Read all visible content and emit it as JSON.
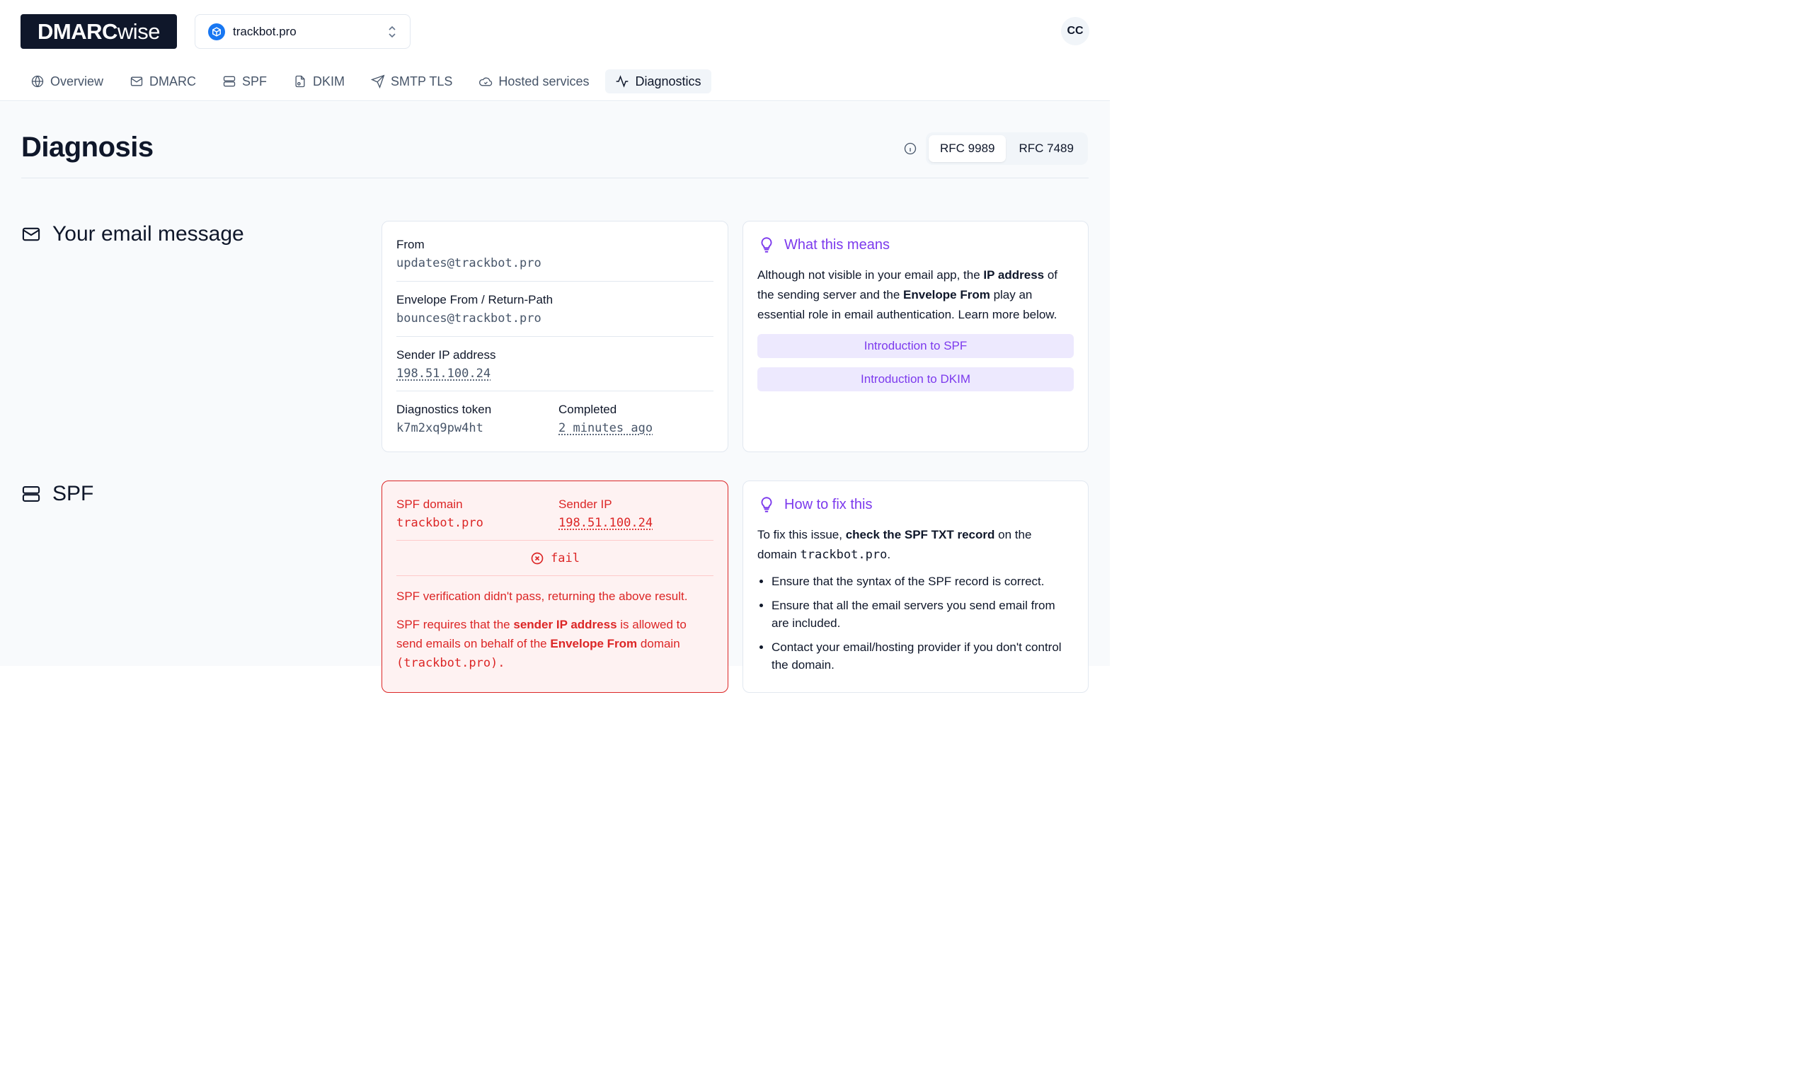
{
  "header": {
    "logo_bold": "DMARC",
    "logo_light": "wise",
    "domain": "trackbot.pro",
    "avatar": "CC"
  },
  "tabs": [
    {
      "label": "Overview",
      "icon": "globe-icon"
    },
    {
      "label": "DMARC",
      "icon": "mail-icon"
    },
    {
      "label": "SPF",
      "icon": "server-icon"
    },
    {
      "label": "DKIM",
      "icon": "file-key-icon"
    },
    {
      "label": "SMTP TLS",
      "icon": "send-icon"
    },
    {
      "label": "Hosted services",
      "icon": "cloud-icon"
    },
    {
      "label": "Diagnostics",
      "icon": "activity-icon",
      "active": true
    }
  ],
  "page": {
    "title": "Diagnosis",
    "rfc_options": [
      "RFC 9989",
      "RFC 7489"
    ],
    "rfc_selected": "RFC 9989"
  },
  "email_section": {
    "title": "Your email message",
    "from_label": "From",
    "from_value": "updates@trackbot.pro",
    "envelope_label": "Envelope From / Return-Path",
    "envelope_value": "bounces@trackbot.pro",
    "ip_label": "Sender IP address",
    "ip_value": "198.51.100.24",
    "token_label": "Diagnostics token",
    "token_value": "k7m2xq9pw4ht",
    "completed_label": "Completed",
    "completed_value": "2 minutes ago"
  },
  "what_means": {
    "title": "What this means",
    "text_1": "Although not visible in your email app, the ",
    "bold_1": "IP address",
    "text_2": " of the sending server and the ",
    "bold_2": "Envelope From",
    "text_3": " play an essential role in email authentication. Learn more below.",
    "btn_spf": "Introduction to SPF",
    "btn_dkim": "Introduction to DKIM"
  },
  "spf_section": {
    "title": "SPF",
    "domain_label": "SPF domain",
    "domain_value": "trackbot.pro",
    "ip_label": "Sender IP",
    "ip_value": "198.51.100.24",
    "result": "fail",
    "msg_1": "SPF verification didn't pass, returning the above result.",
    "msg_2a": "SPF requires that the ",
    "msg_2b": "sender IP address",
    "msg_2c": " is allowed to send emails on behalf of the ",
    "msg_2d": "Envelope From",
    "msg_2e": " domain",
    "msg_2f": "(trackbot.pro)."
  },
  "how_fix": {
    "title": "How to fix this",
    "text_1": "To fix this issue, ",
    "bold_1": "check the SPF TXT record",
    "text_2": " on the domain ",
    "code_1": "trackbot.pro",
    "text_3": ".",
    "items": [
      "Ensure that the syntax of the SPF record is correct.",
      "Ensure that all the email servers you send email from are included.",
      "Contact your email/hosting provider if you don't control the domain."
    ]
  },
  "colors": {
    "accent": "#7c3aed",
    "danger": "#dc2626",
    "brand": "#0f172a"
  }
}
